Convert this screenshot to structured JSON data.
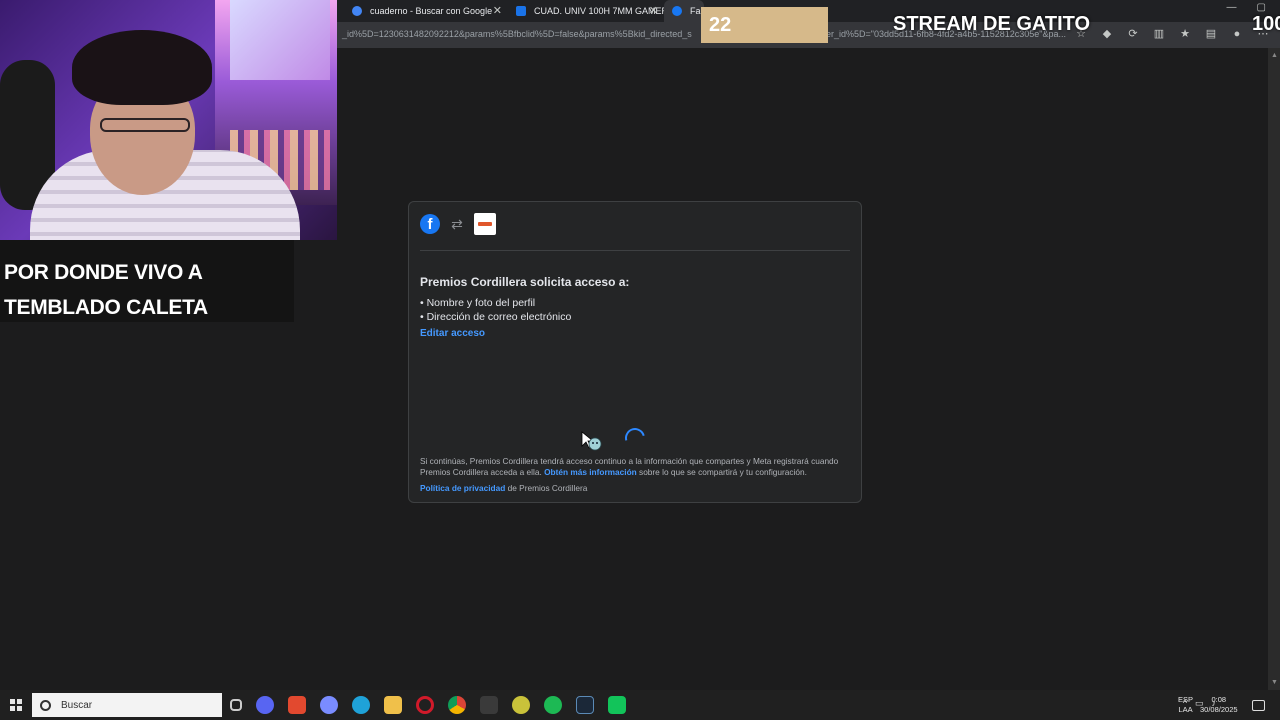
{
  "browser": {
    "tabs": [
      {
        "label": "cuaderno - Buscar con Google",
        "favicon_color": "#4285f4"
      },
      {
        "label": "CUAD. UNIV 100H 7MM GAMER",
        "favicon_color": "#1a73e8"
      },
      {
        "label": "Fa",
        "favicon_color": "#1877f2"
      }
    ],
    "url_left": "_id%5D=1230631482092212&params%5Bfbclid%5D=false&params%5Bkid_directed_s",
    "url_right": "er_id%5D=\"03dd5d11-6fb8-4fd2-a4b5-1152812c305e\"&pa..."
  },
  "dialog": {
    "title": "Premios Cordillera solicita acceso a:",
    "permissions": [
      "• Nombre y foto del perfil",
      "• Dirección de correo electrónico"
    ],
    "edit_link": "Editar acceso",
    "note_prefix": "Si continúas, Premios Cordillera tendrá acceso continuo a la información que compartes y Meta registrará cuando Premios Cordillera acceda a ella.",
    "note_link": "Obtén más información",
    "note_suffix": "sobre lo que se compartirá y tu configuración.",
    "policy_link": "Política de privacidad",
    "policy_suffix": "de Premios Cordillera",
    "brand_color": "#1877f2",
    "link_color": "#4599ff"
  },
  "overlay": {
    "caption_line1": "POR DONDE VIVO A",
    "caption_line2": "TEMBLADO CALETA",
    "counter": "22",
    "stream_title": "STREAM DE GATITO",
    "right_number": "100"
  },
  "taskbar": {
    "search_placeholder": "Buscar",
    "lang_line1": "ESP",
    "lang_line2": "LAA",
    "time": "0:08",
    "date": "30/08/2025",
    "app_icons": [
      "task-view-icon",
      "discord-icon",
      "app-icon-red",
      "app-icon-swirl",
      "edge-icon",
      "file-explorer-icon",
      "opera-icon",
      "chrome-icon",
      "app-icon-dark",
      "app-icon-yellow",
      "spotify-icon",
      "steam-icon",
      "app-icon-green"
    ]
  }
}
